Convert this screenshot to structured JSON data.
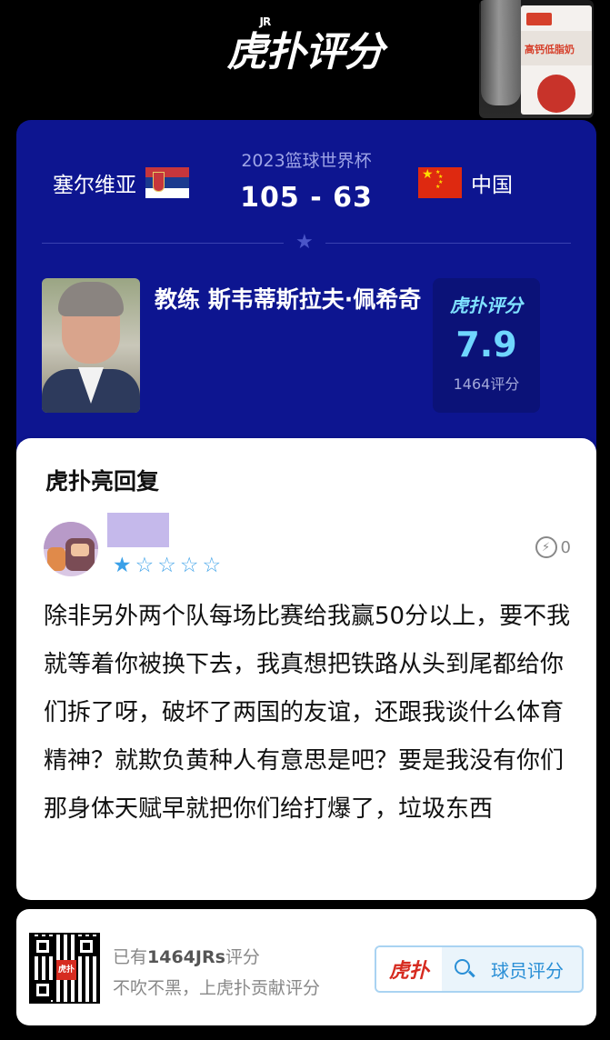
{
  "header": {
    "logo_text": "虎扑评分",
    "logo_superscript": "JR",
    "ad_text": "高钙低脂奶"
  },
  "match": {
    "event": "2023篮球世界杯",
    "team_left": "塞尔维亚",
    "team_right": "中国",
    "score": "105  -  63",
    "team_left_flag": "serbia-flag",
    "team_right_flag": "china-flag"
  },
  "coach": {
    "name": "教练 斯韦蒂斯拉夫·佩希奇",
    "rating_logo": "虎扑评分",
    "rating_score": "7.9",
    "rating_count": "1464评分"
  },
  "reply": {
    "title": "虎扑亮回复",
    "stars_filled": 1,
    "stars_total": 5,
    "likes": "0",
    "text": "除非另外两个队每场比赛给我赢50分以上，要不我就等着你被换下去，我真想把铁路从头到尾都给你们拆了呀，破坏了两国的友谊，还跟我谈什么体育精神？就欺负黄种人有意思是吧？要是我没有你们那身体天赋早就把你们给打爆了，垃圾东西"
  },
  "footer": {
    "line1_prefix": "已有",
    "line1_count": "1464JRs",
    "line1_suffix": "评分",
    "line2": "不吹不黑，上虎扑贡献评分",
    "qr_logo": "虎扑",
    "button_logo": "虎扑",
    "button_label": "球员评分"
  },
  "colors": {
    "card_blue": "#0d1590",
    "rating_cyan": "#6fd6ff",
    "star_blue": "#3aa0e8",
    "brand_red": "#d62b20"
  }
}
